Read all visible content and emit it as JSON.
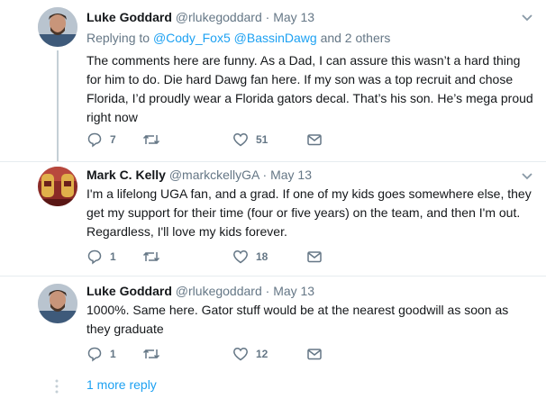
{
  "tweets": [
    {
      "name": "Luke Goddard",
      "handle": "@rlukegoddard",
      "dot": "·",
      "time": "May 13",
      "reply_prefix": "Replying to",
      "mention1": "@Cody_Fox5",
      "mention2": "@BassinDawg",
      "reply_suffix": "and 2 others",
      "text": "The comments here are funny. As a Dad, I can assure this wasn’t a hard thing for him to do. Die hard Dawg fan here. If my son was a top recruit and chose Florida, I’d proudly wear a Florida gators decal. That’s his son. He’s mega proud right now",
      "replies": "7",
      "retweets": "",
      "likes": "51"
    },
    {
      "name": "Mark C. Kelly",
      "handle": "@markckellyGA",
      "dot": "·",
      "time": "May 13",
      "text": "I'm a lifelong UGA fan, and a grad. If one of my kids goes somewhere else, they get my support for their time (four or five years) on the team, and then I'm out. Regardless, I'll love my kids forever.",
      "replies": "1",
      "retweets": "",
      "likes": "18"
    },
    {
      "name": "Luke Goddard",
      "handle": "@rlukegoddard",
      "dot": "·",
      "time": "May 13",
      "text": "1000%. Same here. Gator stuff would be at the nearest goodwill as soon as they graduate",
      "replies": "1",
      "retweets": "",
      "likes": "12"
    }
  ],
  "more_replies": "1 more reply",
  "colors": {
    "link": "#1da1f2",
    "muted": "#657786",
    "divider": "#e6ecf0"
  }
}
